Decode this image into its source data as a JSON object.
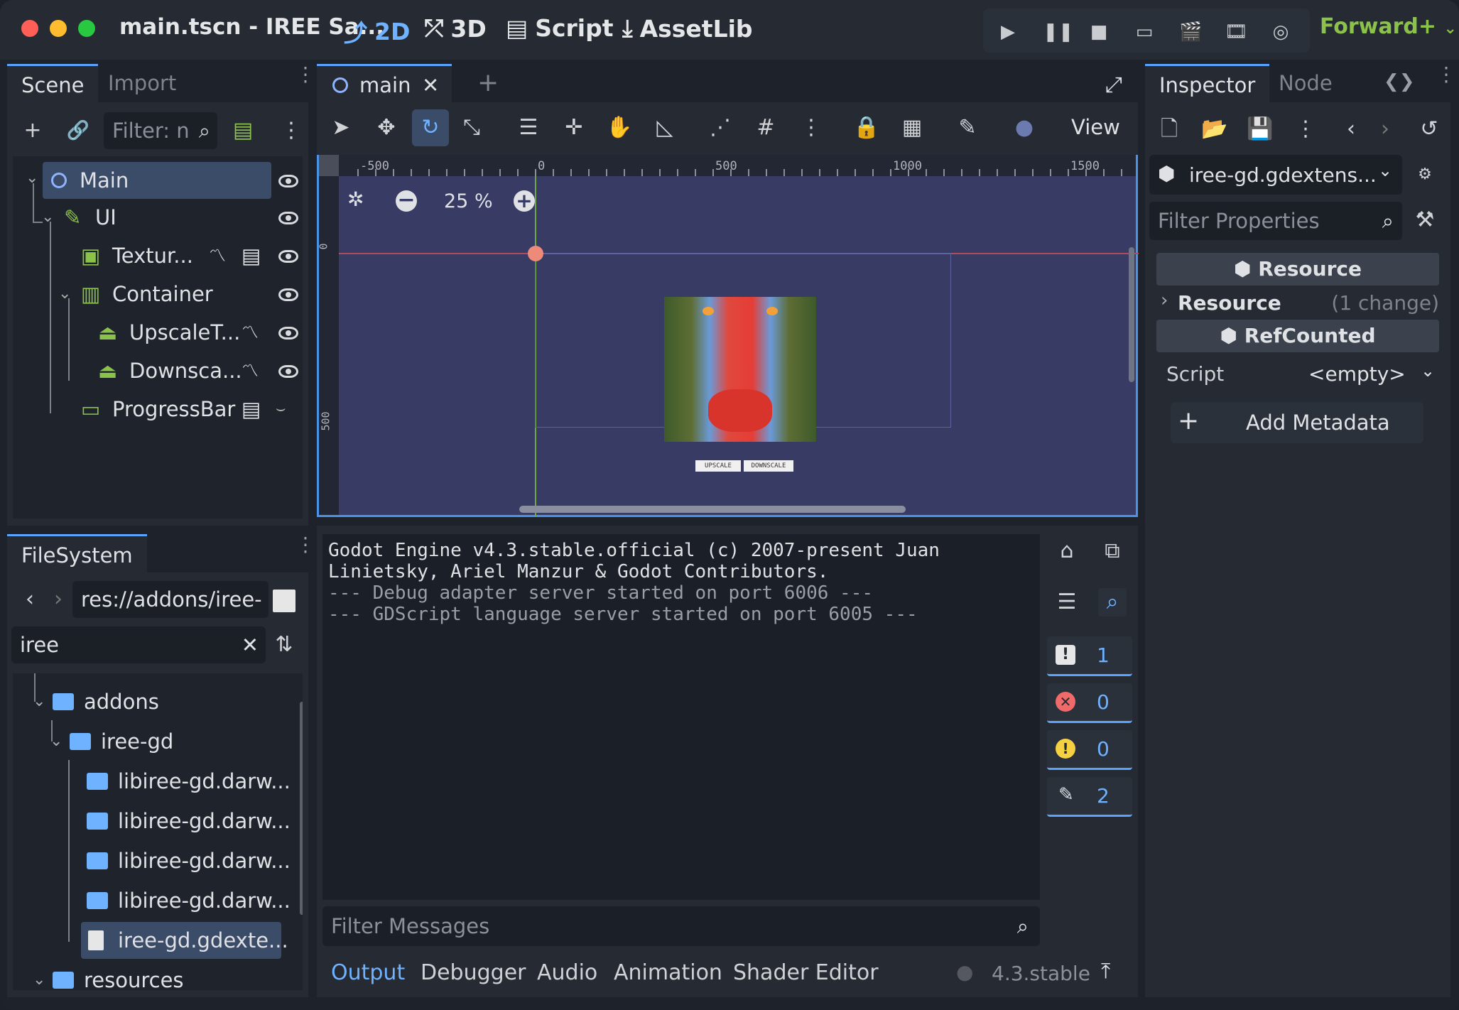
{
  "window": {
    "title": "main.tscn - IREE Sa...",
    "workspaces": [
      "2D",
      "3D",
      "Script",
      "AssetLib"
    ],
    "renderer": "Forward+"
  },
  "scene_dock": {
    "tabs": [
      "Scene",
      "Import"
    ],
    "filter_placeholder": "Filter: n",
    "nodes": [
      {
        "label": "Main",
        "icon": "node-circle-icon"
      },
      {
        "label": "UI",
        "icon": "control-edit-icon"
      },
      {
        "label": "Textur...",
        "icon": "texture-rect-icon"
      },
      {
        "label": "Container",
        "icon": "container-icon"
      },
      {
        "label": "UpscaleT...",
        "icon": "button-icon"
      },
      {
        "label": "Downsca...",
        "icon": "button-icon"
      },
      {
        "label": "ProgressBar",
        "icon": "progressbar-icon"
      }
    ]
  },
  "filesystem": {
    "tab": "FileSystem",
    "path": "res://addons/iree-",
    "search": "iree",
    "items": [
      {
        "label": "addons",
        "type": "folder"
      },
      {
        "label": "iree-gd",
        "type": "folder"
      },
      {
        "label": "libiree-gd.darw...",
        "type": "folder"
      },
      {
        "label": "libiree-gd.darw...",
        "type": "folder"
      },
      {
        "label": "libiree-gd.darw...",
        "type": "folder"
      },
      {
        "label": "libiree-gd.darw...",
        "type": "folder"
      },
      {
        "label": "iree-gd.gdexte...",
        "type": "file"
      },
      {
        "label": "resources",
        "type": "folder"
      }
    ]
  },
  "editor": {
    "tab": "main",
    "view_label": "View",
    "zoom": "25 %",
    "ruler_labels": [
      "-500",
      "0",
      "500",
      "1000",
      "1500"
    ],
    "ruler_left_labels": [
      "0",
      "500"
    ],
    "buttons_in_scene": [
      "UPSCALE",
      "DOWNSCALE"
    ]
  },
  "output": {
    "lines": [
      "Godot Engine v4.3.stable.official (c) 2007-present Juan",
      "Linietsky, Ariel Manzur & Godot Contributors.",
      "--- Debug adapter server started on port 6006 ---",
      "--- GDScript language server started on port 6005 ---"
    ],
    "counts": {
      "messages": "1",
      "errors": "0",
      "warnings": "0",
      "editor": "2"
    },
    "filter_placeholder": "Filter Messages",
    "bottom_tabs": [
      "Output",
      "Debugger",
      "Audio",
      "Animation",
      "Shader Editor"
    ],
    "version": "4.3.stable"
  },
  "inspector": {
    "tabs": [
      "Inspector",
      "Node"
    ],
    "resource_name": "iree-gd.gdextens...",
    "filter_placeholder": "Filter Properties",
    "section1": "Resource",
    "resource_row_label": "Resource",
    "resource_row_value": "(1 change)",
    "section2": "RefCounted",
    "script_label": "Script",
    "script_value": "<empty>",
    "add_metadata": "Add Metadata"
  },
  "colors": {
    "accent": "#5aa3ff",
    "renderer": "#8bc34a",
    "viewport_bg": "#383b63"
  }
}
